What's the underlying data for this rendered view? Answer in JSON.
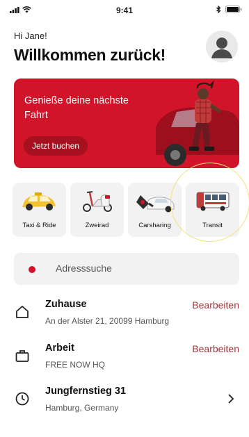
{
  "status_bar": {
    "time": "9:41"
  },
  "header": {
    "greeting": "Hi Jane!",
    "title": "Willkommen zurück!"
  },
  "promo": {
    "text": "Genieße deine nächste Fahrt",
    "button_label": "Jetzt buchen",
    "background_color": "#d2142b"
  },
  "services": [
    {
      "label": "Taxi & Ride",
      "icon": "taxi-icon"
    },
    {
      "label": "Zweirad",
      "icon": "scooter-icon"
    },
    {
      "label": "Carsharing",
      "icon": "carsharing-icon"
    },
    {
      "label": "Transit",
      "icon": "bus-icon"
    }
  ],
  "search": {
    "placeholder": "Adresssuche"
  },
  "places": [
    {
      "title": "Zuhause",
      "subtitle": "An der Alster 21, 20099 Hamburg",
      "action": "Bearbeiten",
      "icon": "home-icon"
    },
    {
      "title": "Arbeit",
      "subtitle": "FREE NOW HQ",
      "action": "Bearbeiten",
      "icon": "briefcase-icon"
    },
    {
      "title": "Jungfernstieg 31",
      "subtitle": "Hamburg, Germany",
      "icon": "clock-icon"
    }
  ],
  "colors": {
    "accent": "#d2142b",
    "action_text": "#a4343a",
    "card_bg": "#f2f2f2"
  }
}
